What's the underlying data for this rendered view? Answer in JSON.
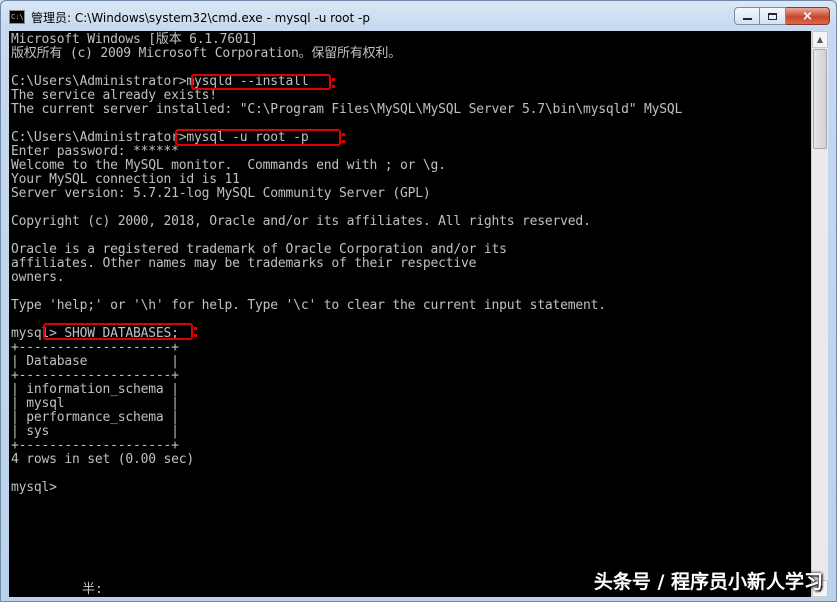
{
  "window": {
    "title": "管理员: C:\\Windows\\system32\\cmd.exe - mysql  -u root -p",
    "icon": "cmd-icon",
    "controls": {
      "minimize": "minimize-icon",
      "maximize": "maximize-icon",
      "close": "×"
    }
  },
  "console": {
    "lines": [
      "Microsoft Windows [版本 6.1.7601]",
      "版权所有 (c) 2009 Microsoft Corporation。保留所有权利。",
      "",
      "C:\\Users\\Administrator>mysqld --install",
      "The service already exists!",
      "The current server installed: \"C:\\Program Files\\MySQL\\MySQL Server 5.7\\bin\\mysqld\" MySQL",
      "",
      "C:\\Users\\Administrator>mysql -u root -p",
      "Enter password: ******",
      "Welcome to the MySQL monitor.  Commands end with ; or \\g.",
      "Your MySQL connection id is 11",
      "Server version: 5.7.21-log MySQL Community Server (GPL)",
      "",
      "Copyright (c) 2000, 2018, Oracle and/or its affiliates. All rights reserved.",
      "",
      "Oracle is a registered trademark of Oracle Corporation and/or its",
      "affiliates. Other names may be trademarks of their respective",
      "owners.",
      "",
      "Type 'help;' or '\\h' for help. Type '\\c' to clear the current input statement.",
      "",
      "mysql> SHOW DATABASES;",
      "+--------------------+",
      "| Database           |",
      "+--------------------+",
      "| information_schema |",
      "| mysql              |",
      "| performance_schema |",
      "| sys                |",
      "+--------------------+",
      "4 rows in set (0.00 sec)",
      "",
      "mysql>"
    ],
    "ime_status": "半:"
  },
  "highlight_color": "#e00000",
  "watermark": "头条号 / 程序员小新人学习"
}
